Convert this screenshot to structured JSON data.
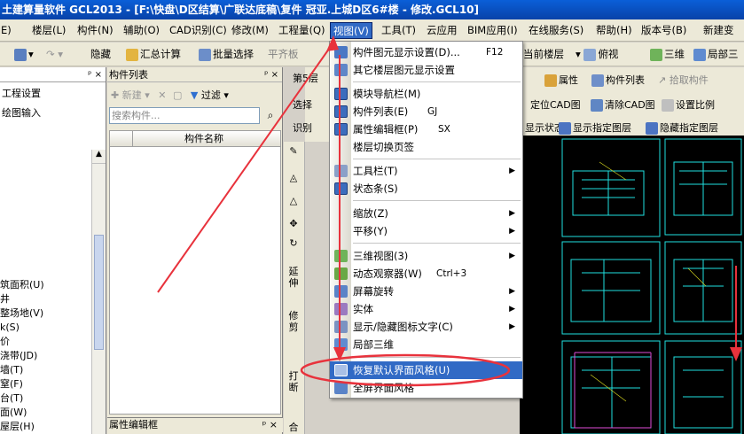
{
  "window": {
    "title": "土建算量软件 GCL2013 - [F:\\快盘\\D区结算\\广联达底稿\\复件 冠亚.上城D区6#楼 - 修改.GCL10]"
  },
  "menubar": [
    {
      "label": "楼层(L)"
    },
    {
      "label": "构件(N)"
    },
    {
      "label": "辅助(O)"
    },
    {
      "label": "CAD识别(C)"
    },
    {
      "label": "修改(M)"
    },
    {
      "label": "工程量(Q)"
    },
    {
      "label": "视图(V)"
    },
    {
      "label": "工具(T)"
    },
    {
      "label": "云应用"
    },
    {
      "label": "BIM应用(I)"
    },
    {
      "label": "在线服务(S)"
    },
    {
      "label": "帮助(H)"
    },
    {
      "label": "版本号(B)"
    },
    {
      "label": "新建变"
    }
  ],
  "toolbar": {
    "hide": "隐藏",
    "summary": "汇总计算",
    "batch_select": "批量选择",
    "flat_slab": "平齐板",
    "current_floor": "当前楼层",
    "view_mode": "俯视",
    "three_d": "三维",
    "local_three": "局部三"
  },
  "left_panel": {
    "items": [
      "工程设置",
      "绘图输入"
    ],
    "lower_items": [
      "筑面积(U)",
      "井",
      "整场地(V)",
      "k(S)",
      "价",
      "浇带(JD)",
      "墙(T)",
      "窒(F)",
      "台(T)",
      "面(W)",
      "屋层(H)"
    ]
  },
  "component_panel": {
    "title": "构件列表",
    "new_label": "新建",
    "filter_label": "过滤",
    "search_placeholder": "搜索构件...",
    "column_name": "构件名称",
    "property_title": "属性编辑框"
  },
  "vertical_tools": {
    "extend": "延伸",
    "modify": "修剪",
    "break": "打断",
    "merge": "合"
  },
  "upper_area": {
    "floor": "第5层",
    "select": "选择",
    "identify": "识别",
    "property": "属性",
    "component_list": "构件列表",
    "pick": "拾取构件",
    "locate_cad": "定位CAD图",
    "clear_cad": "清除CAD图",
    "set_scale": "设置比例",
    "display_state": "显示状态",
    "show_layer": "显示指定图层",
    "hide_layer": "隐藏指定图层"
  },
  "view_menu": {
    "items": [
      {
        "label": "构件图元显示设置(D)...",
        "shortcut": "F12"
      },
      {
        "label": "其它楼层图元显示设置"
      },
      {
        "label": "模块导航栏(M)"
      },
      {
        "label": "构件列表(E)",
        "shortcut": "GJ"
      },
      {
        "label": "属性编辑框(P)",
        "shortcut": "SX"
      },
      {
        "label": "楼层切换页签"
      },
      {
        "label": "工具栏(T)",
        "submenu": "▶"
      },
      {
        "label": "状态条(S)"
      },
      {
        "label": "缩放(Z)",
        "submenu": "▶"
      },
      {
        "label": "平移(Y)",
        "submenu": "▶"
      },
      {
        "label": "三维视图(3)",
        "submenu": "▶"
      },
      {
        "label": "动态观察器(W)",
        "shortcut": "Ctrl+3"
      },
      {
        "label": "屏幕旋转",
        "submenu": "▶"
      },
      {
        "label": "实体",
        "submenu": "▶"
      },
      {
        "label": "显示/隐藏图标文字(C)",
        "submenu": "▶"
      },
      {
        "label": "局部三维"
      },
      {
        "label": "恢复默认界面风格(U)"
      },
      {
        "label": "全屏界面风格"
      }
    ]
  },
  "colors": {
    "highlight": "#316ac5",
    "annotation": "#e8323c",
    "cad_line": "#20e0e0"
  }
}
